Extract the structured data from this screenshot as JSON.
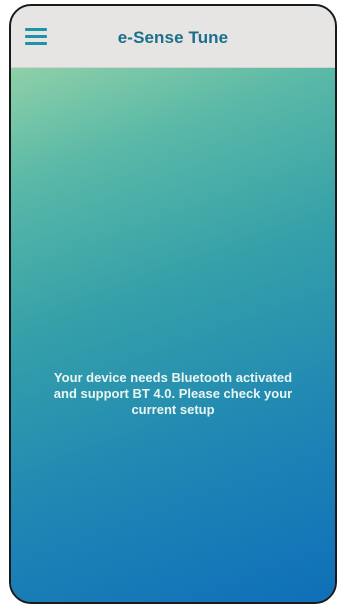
{
  "header": {
    "menu_icon": "hamburger-menu-icon",
    "title": "e-Sense Tune"
  },
  "main": {
    "message": "Your device needs Bluetooth activated\nand support BT 4.0. Please check your\ncurrent setup"
  },
  "colors": {
    "header_background": "#e6e5e3",
    "title_color": "#1b6f8c",
    "menu_icon_color": "#1f93a8",
    "gradient_top": "#8fd0a8",
    "gradient_bottom": "#0f6fb9"
  }
}
